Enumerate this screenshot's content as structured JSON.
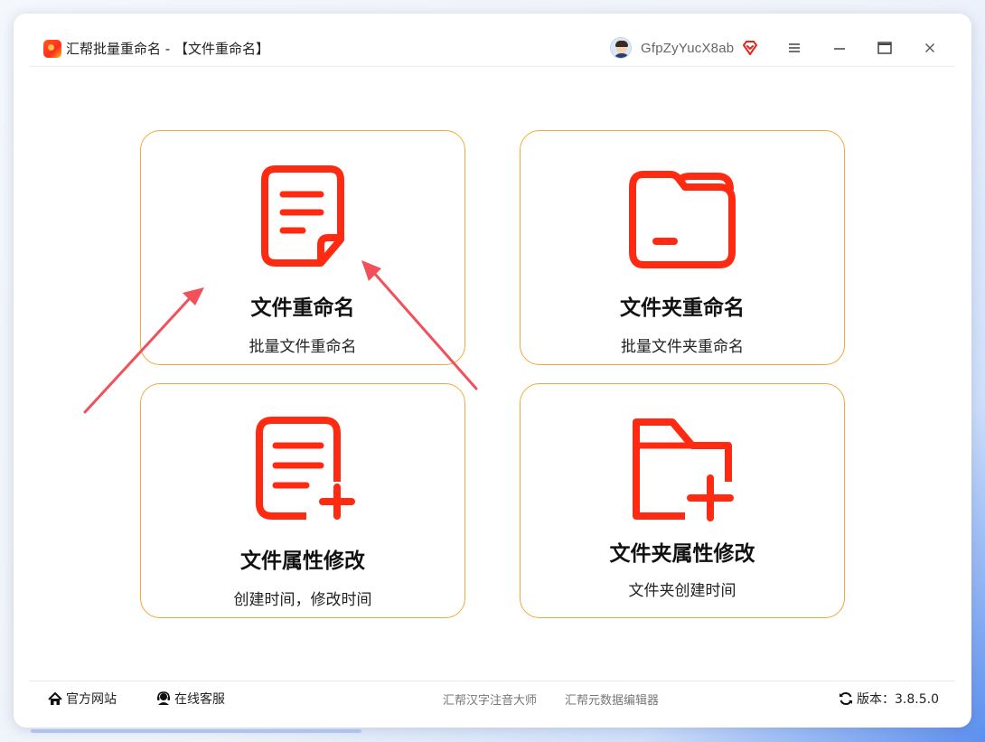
{
  "window": {
    "title": "汇帮批量重命名 - 【文件重命名】",
    "username": "GfpZyYucX8ab"
  },
  "cards": [
    {
      "title": "文件重命名",
      "subtitle": "批量文件重命名",
      "icon": "document-icon"
    },
    {
      "title": "文件夹重命名",
      "subtitle": "批量文件夹重命名",
      "icon": "folder-icon"
    },
    {
      "title": "文件属性修改",
      "subtitle": "创建时间，修改时间",
      "icon": "document-add-icon"
    },
    {
      "title": "文件夹属性修改",
      "subtitle": "文件夹创建时间",
      "icon": "folder-add-icon"
    }
  ],
  "footer": {
    "website": "官方网站",
    "support": "在线客服",
    "link1": "汇帮汉字注音大师",
    "link2": "汇帮元数据编辑器",
    "version": "版本：3.8.5.0"
  },
  "colors": {
    "accent": "#ff2a12",
    "card_border": "#f2a93a",
    "arrow": "#f2505a"
  }
}
